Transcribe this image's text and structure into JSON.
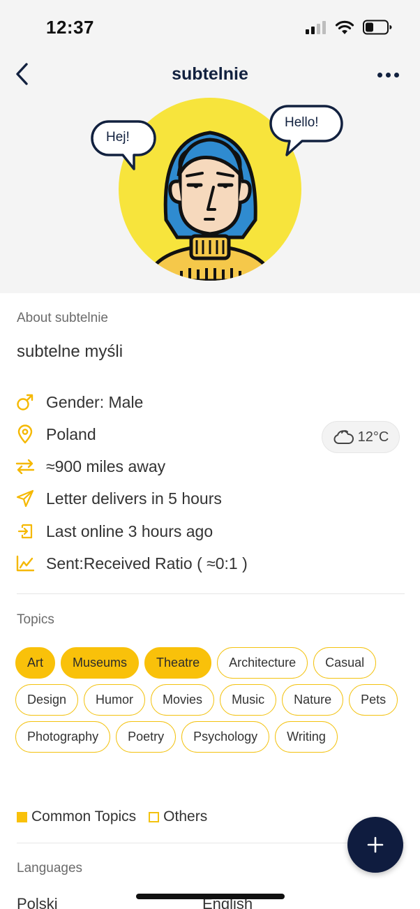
{
  "status_bar": {
    "time": "12:37"
  },
  "nav": {
    "title": "subtelnie"
  },
  "avatar": {
    "bubble_left": "Hej!",
    "bubble_right": "Hello!"
  },
  "about": {
    "label": "About subtelnie",
    "bio": "subtelne myśli"
  },
  "info": {
    "gender": "Gender: Male",
    "country": "Poland",
    "distance": "≈900 miles away",
    "delivery": "Letter delivers in 5 hours",
    "last_online": "Last online 3 hours ago",
    "ratio": "Sent:Received Ratio ( ≈0:1 )"
  },
  "weather": {
    "temp": "12°C",
    "icon": "cloud-icon"
  },
  "topics": {
    "label": "Topics",
    "items": [
      {
        "label": "Art",
        "common": true
      },
      {
        "label": "Museums",
        "common": true
      },
      {
        "label": "Theatre",
        "common": true
      },
      {
        "label": "Architecture",
        "common": false
      },
      {
        "label": "Casual",
        "common": false
      },
      {
        "label": "Design",
        "common": false
      },
      {
        "label": "Humor",
        "common": false
      },
      {
        "label": "Movies",
        "common": false
      },
      {
        "label": "Music",
        "common": false
      },
      {
        "label": "Nature",
        "common": false
      },
      {
        "label": "Pets",
        "common": false
      },
      {
        "label": "Photography",
        "common": false
      },
      {
        "label": "Poetry",
        "common": false
      },
      {
        "label": "Psychology",
        "common": false
      },
      {
        "label": "Writing",
        "common": false
      }
    ],
    "legend_common": "Common Topics",
    "legend_others": "Others"
  },
  "languages": {
    "label": "Languages",
    "items": [
      "Polski",
      "English"
    ]
  },
  "colors": {
    "accent": "#f9c10a",
    "navy": "#0f1c3f",
    "avatar_bg": "#f7e43c"
  }
}
